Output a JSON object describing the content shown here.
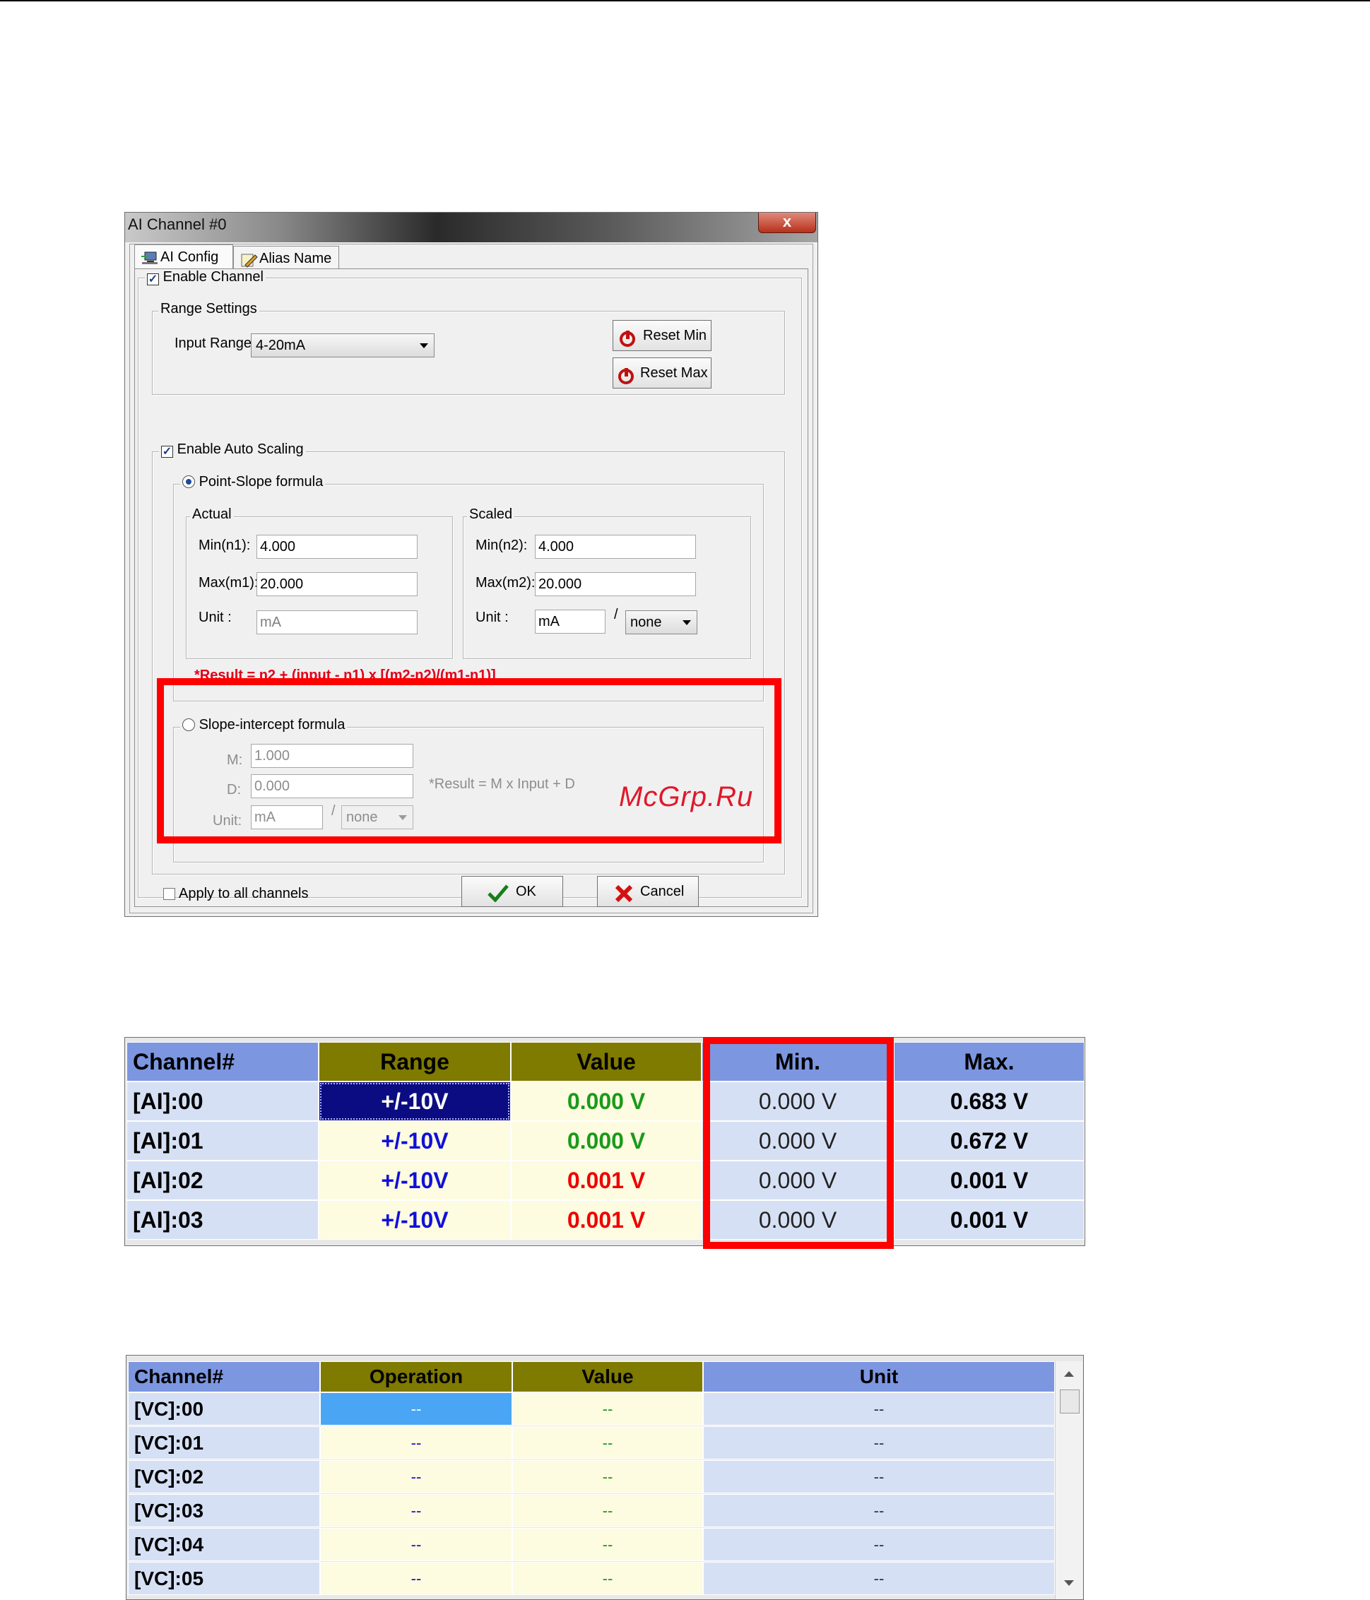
{
  "dialog": {
    "title": "AI Channel #0",
    "close_label": "x",
    "tabs": [
      {
        "label": "AI Config"
      },
      {
        "label": "Alias Name"
      }
    ],
    "enable_channel_label": "Enable Channel",
    "range_settings": {
      "legend": "Range Settings",
      "input_range_label": "Input Range :",
      "input_range_value": "4-20mA",
      "reset_min_label": "Reset Min",
      "reset_max_label": "Reset Max"
    },
    "auto_scaling": {
      "legend": "Enable Auto Scaling",
      "point_slope": {
        "label": "Point-Slope formula",
        "actual": {
          "legend": "Actual",
          "min_label": "Min(n1):",
          "min_value": "4.000",
          "max_label": "Max(m1):",
          "max_value": "20.000",
          "unit_label": "Unit :",
          "unit_value": "mA"
        },
        "scaled": {
          "legend": "Scaled",
          "min_label": "Min(n2):",
          "min_value": "4.000",
          "max_label": "Max(m2):",
          "max_value": "20.000",
          "unit_label": "Unit :",
          "unit_value": "mA",
          "slash": "/",
          "per_value": "none"
        },
        "formula": "*Result = n2 + (input - n1) x [(m2-n2)/(m1-n1)]"
      },
      "slope_intercept": {
        "label": "Slope-intercept formula",
        "m_label": "M:",
        "m_value": "1.000",
        "d_label": "D:",
        "d_value": "0.000",
        "unit_label": "Unit:",
        "unit_value": "mA",
        "slash": "/",
        "per_value": "none",
        "formula": "*Result = M x Input + D"
      }
    },
    "watermark": "McGrp.Ru",
    "apply_all_label": "Apply to all channels",
    "ok_label": "OK",
    "cancel_label": "Cancel"
  },
  "ai_table": {
    "headers": [
      "Channel#",
      "Range",
      "Value",
      "Min.",
      "Max."
    ],
    "rows": [
      {
        "channel": "[AI]:00",
        "range": "+/-10V",
        "value": "0.000 V",
        "value_color": "#1a9a1a",
        "min": "0.000 V",
        "max": "0.683 V"
      },
      {
        "channel": "[AI]:01",
        "range": "+/-10V",
        "value": "0.000 V",
        "value_color": "#1a9a1a",
        "min": "0.000 V",
        "max": "0.672 V"
      },
      {
        "channel": "[AI]:02",
        "range": "+/-10V",
        "value": "0.001 V",
        "value_color": "#ee0000",
        "min": "0.000 V",
        "max": "0.001 V"
      },
      {
        "channel": "[AI]:03",
        "range": "+/-10V",
        "value": "0.001 V",
        "value_color": "#ee0000",
        "min": "0.000 V",
        "max": "0.001 V"
      }
    ]
  },
  "vc_table": {
    "headers": [
      "Channel#",
      "Operation",
      "Value",
      "Unit"
    ],
    "rows": [
      {
        "channel": "[VC]:00",
        "operation": "--",
        "value": "--",
        "unit": "--"
      },
      {
        "channel": "[VC]:01",
        "operation": "--",
        "value": "--",
        "unit": "--"
      },
      {
        "channel": "[VC]:02",
        "operation": "--",
        "value": "--",
        "unit": "--"
      },
      {
        "channel": "[VC]:03",
        "operation": "--",
        "value": "--",
        "unit": "--"
      },
      {
        "channel": "[VC]:04",
        "operation": "--",
        "value": "--",
        "unit": "--"
      },
      {
        "channel": "[VC]:05",
        "operation": "--",
        "value": "--",
        "unit": "--"
      }
    ]
  },
  "colors": {
    "header_blue": "#7c96e0",
    "header_olive": "#7f7a00",
    "row_blue": "#d6e0f5",
    "row_cream": "#fdfbe0",
    "selected_navy": "#0c0c82",
    "selected_light": "#4aa6f4",
    "range_text_blue": "#1010d8",
    "highlight_red": "#ff0000"
  }
}
